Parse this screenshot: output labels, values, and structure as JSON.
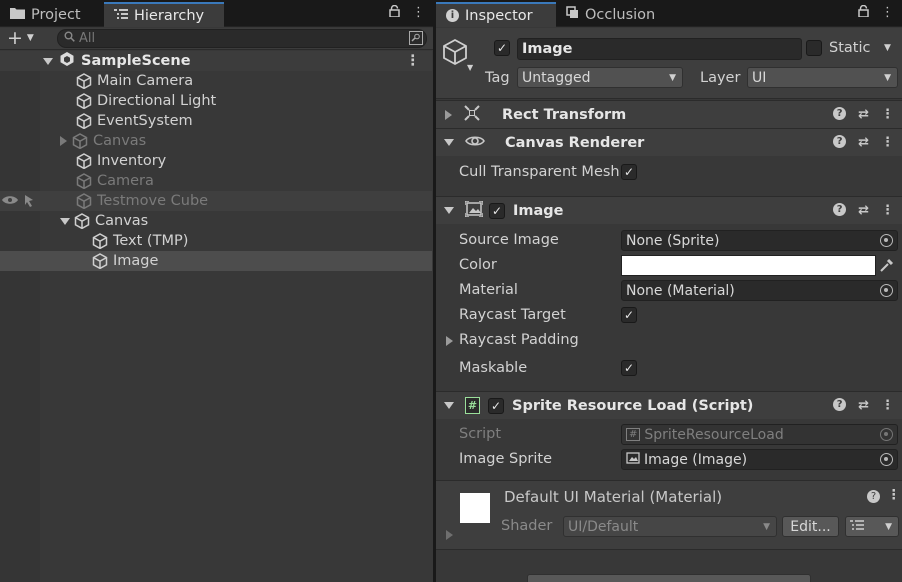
{
  "left_panel": {
    "tabs": [
      {
        "label": "Project"
      },
      {
        "label": "Hierarchy"
      }
    ],
    "search_placeholder": "All",
    "scene": "SampleScene",
    "tree": [
      {
        "label": "Main Camera",
        "level": 1,
        "dim": false
      },
      {
        "label": "Directional Light",
        "level": 1,
        "dim": false
      },
      {
        "label": "EventSystem",
        "level": 1,
        "dim": false
      },
      {
        "label": "Canvas",
        "level": 1,
        "dim": true,
        "expander": "collapsed"
      },
      {
        "label": "Inventory",
        "level": 1,
        "dim": false
      },
      {
        "label": "Camera",
        "level": 1,
        "dim": true
      },
      {
        "label": "Testmove Cube",
        "level": 1,
        "dim": true,
        "hidden": true
      },
      {
        "label": "Canvas",
        "level": 1,
        "dim": false,
        "expander": "expanded"
      },
      {
        "label": "Text (TMP)",
        "level": 2,
        "dim": false
      },
      {
        "label": "Image",
        "level": 2,
        "dim": false,
        "selected": true
      }
    ]
  },
  "inspector": {
    "tabs": [
      {
        "label": "Inspector"
      },
      {
        "label": "Occlusion"
      }
    ],
    "object_name": "Image",
    "static_label": "Static",
    "tag_label": "Tag",
    "tag_value": "Untagged",
    "layer_label": "Layer",
    "layer_value": "UI",
    "components": {
      "rect_transform": "Rect Transform",
      "canvas_renderer": "Canvas Renderer",
      "image": "Image",
      "script": "Sprite Resource Load (Script)"
    },
    "canvas_renderer_props": {
      "cull_label": "Cull Transparent Mesh"
    },
    "image_props": {
      "source_image_label": "Source Image",
      "source_image_value": "None (Sprite)",
      "color_label": "Color",
      "color_value": "#ffffff",
      "material_label": "Material",
      "material_value": "None (Material)",
      "raycast_target_label": "Raycast Target",
      "raycast_padding_label": "Raycast Padding",
      "maskable_label": "Maskable"
    },
    "script_props": {
      "script_label": "Script",
      "script_value": "SpriteResourceLoad",
      "image_sprite_label": "Image Sprite",
      "image_sprite_value": "Image (Image)"
    },
    "material": {
      "title": "Default UI Material (Material)",
      "shader_label": "Shader",
      "shader_value": "UI/Default",
      "edit_label": "Edit..."
    }
  },
  "colors": {
    "selection": "#4d4d4d",
    "accent": "#3a79bb",
    "panel": "#383838"
  }
}
